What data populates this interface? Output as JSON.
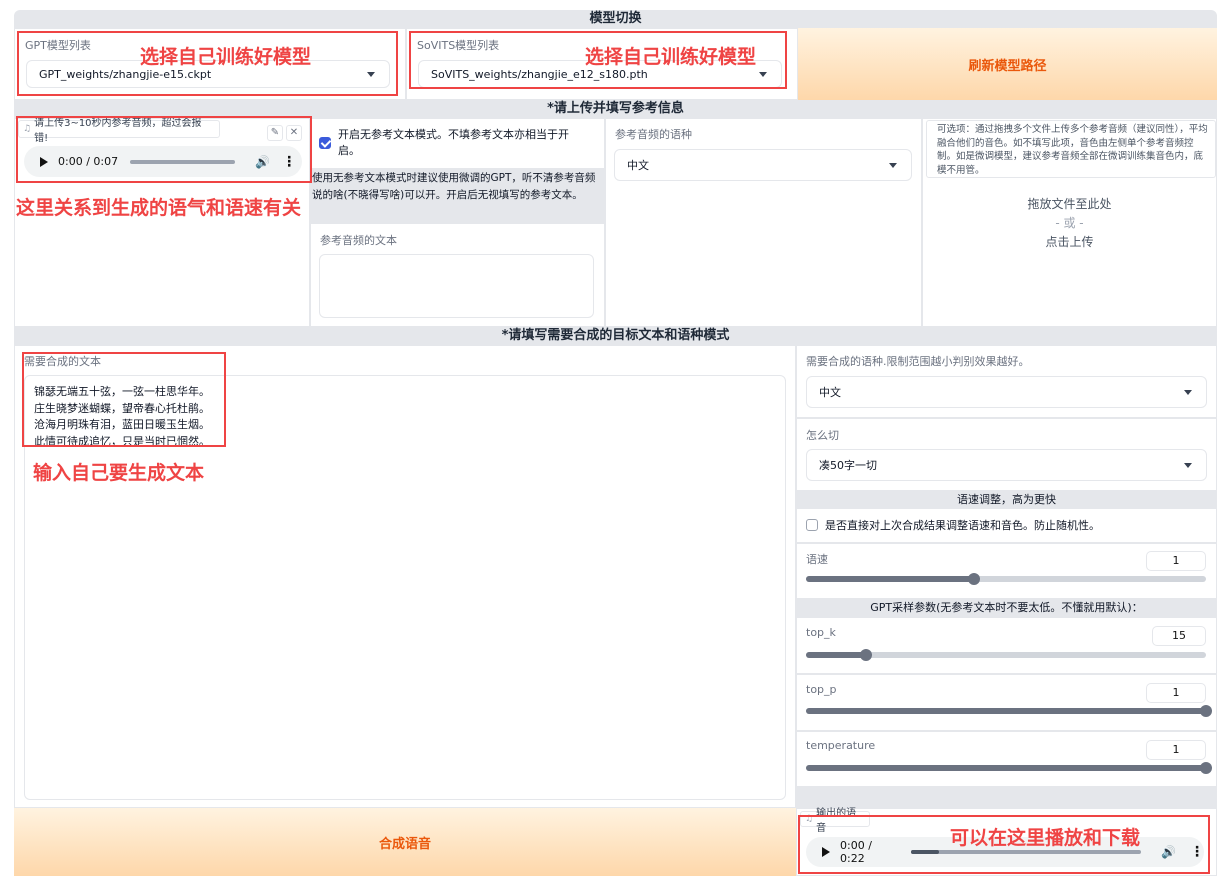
{
  "model_switch": {
    "header": "模型切换",
    "gpt_label": "GPT模型列表",
    "gpt_value": "GPT_weights/zhangjie-e15.ckpt",
    "sovits_label": "SoVITS模型列表",
    "sovits_value": "SoVITS_weights/zhangjie_e12_s180.pth",
    "refresh_button": "刷新模型路径"
  },
  "reference": {
    "header": "*请上传并填写参考信息",
    "audio_chip": "请上传3~10秒内参考音频，超过会报错!",
    "audio_time": "0:00 / 0:07",
    "no_ref_checkbox_label": "开启无参考文本模式。不填参考文本亦相当于开启。",
    "no_ref_checked": true,
    "no_ref_info": "使用无参考文本模式时建议使用微调的GPT，听不清参考音频说的啥(不晓得写啥)可以开。开启后无视填写的参考文本。",
    "ref_text_label": "参考音频的文本",
    "ref_lang_label": "参考音频的语种",
    "ref_lang_value": "中文",
    "multi_upload_info": "可选项：通过拖拽多个文件上传多个参考音频（建议同性），平均融合他们的音色。如不填写此项，音色由左侧单个参考音频控制。如是微调模型，建议参考音频全部在微调训练集音色内，底模不用管。",
    "drop_line1": "拖放文件至此处",
    "drop_line2": "- 或 -",
    "drop_line3": "点击上传"
  },
  "target": {
    "header": "*请填写需要合成的目标文本和语种模式",
    "text_label": "需要合成的文本",
    "text_lines": [
      "锦瑟无端五十弦，一弦一柱思华年。",
      "庄生晓梦迷蝴蝶，望帝春心托杜鹃。",
      "沧海月明珠有泪，蓝田日暖玉生烟。",
      "此情可待成追忆，只是当时已惘然。"
    ],
    "lang_label": "需要合成的语种.限制范围越小判别效果越好。",
    "lang_value": "中文",
    "cut_label": "怎么切",
    "cut_value": "凑50字一切",
    "speed_header": "语速调整，高为更快",
    "speed_checkbox_label": "是否直接对上次合成结果调整语速和音色。防止随机性。",
    "speed_label": "语速",
    "speed_value": "1",
    "speed_fraction": 0.42,
    "gpt_params_header": "GPT采样参数(无参考文本时不要太低。不懂就用默认)：",
    "top_k_label": "top_k",
    "top_k_value": "15",
    "top_k_fraction": 0.15,
    "top_p_label": "top_p",
    "top_p_value": "1",
    "top_p_fraction": 1.0,
    "temperature_label": "temperature",
    "temperature_value": "1",
    "temperature_fraction": 1.0,
    "synth_button": "合成语音",
    "output_chip": "输出的语音",
    "output_time": "0:00 / 0:22",
    "output_progress": 0.12
  },
  "annotations": {
    "gpt_note": "选择自己训练好模型",
    "sovits_note": "选择自己训练好模型",
    "audio_note": "这里关系到生成的语气和语速有关",
    "text_note": "输入自己要生成文本",
    "output_note": "可以在这里播放和下载"
  },
  "colors": {
    "accent_orange": "#ea580c",
    "annotation_red": "#ef4444",
    "checkbox_blue": "#3b5bdb"
  }
}
